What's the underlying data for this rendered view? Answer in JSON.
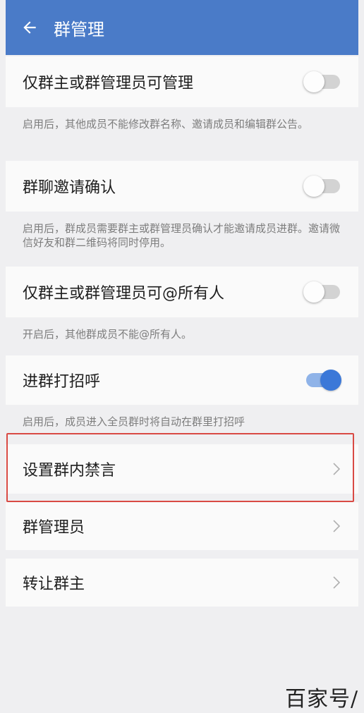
{
  "header": {
    "title": "群管理",
    "back_icon": "arrow-left-icon"
  },
  "settings": [
    {
      "label": "仅群主或群管理员可管理",
      "enabled": false,
      "description": "启用后，其他成员不能修改群名称、邀请成员和编辑群公告。"
    },
    {
      "label": "群聊邀请确认",
      "enabled": false,
      "description": "启用后，群成员需要群主或群管理员确认才能邀请成员进群。邀请微信好友和群二维码将同时停用。"
    },
    {
      "label": "仅群主或群管理员可@所有人",
      "enabled": false,
      "description": "开启后，其他群成员不能@所有人。"
    },
    {
      "label": "进群打招呼",
      "enabled": true,
      "description": "启用后，成员进入全员群时将自动在群里打招呼"
    }
  ],
  "links": [
    {
      "label": "设置群内禁言",
      "highlighted": true
    },
    {
      "label": "群管理员"
    },
    {
      "label": "转让群主"
    }
  ],
  "colors": {
    "appbar": "#4a7bc8",
    "toggle_on": "#3b78d8",
    "highlight_border": "#d94a44"
  },
  "watermark": "百家号/"
}
